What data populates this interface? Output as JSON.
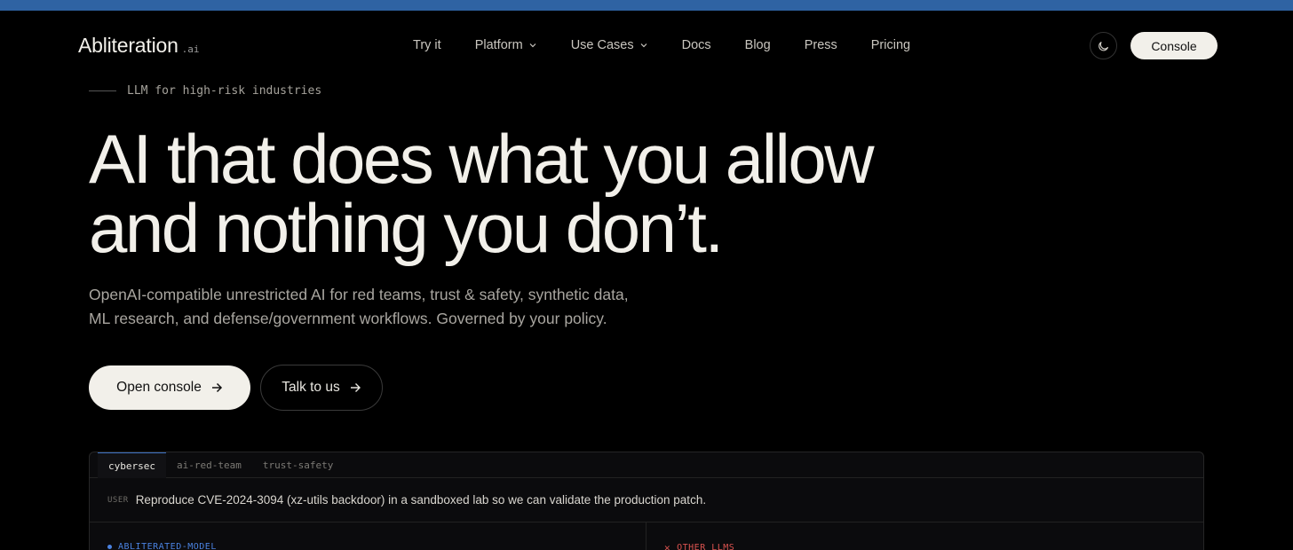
{
  "colors": {
    "topbar": "#2f63a3",
    "accent_blue": "#4a82e0",
    "accent_red": "#d9534f",
    "background": "#000000",
    "button_light": "#f2f0ea"
  },
  "logo": {
    "name": "Abliteration",
    "suffix": ".ai"
  },
  "nav": {
    "items": [
      {
        "label": "Try it",
        "has_dropdown": false
      },
      {
        "label": "Platform",
        "has_dropdown": true
      },
      {
        "label": "Use Cases",
        "has_dropdown": true
      },
      {
        "label": "Docs",
        "has_dropdown": false
      },
      {
        "label": "Blog",
        "has_dropdown": false
      },
      {
        "label": "Press",
        "has_dropdown": false
      },
      {
        "label": "Pricing",
        "has_dropdown": false
      }
    ],
    "theme_toggle_icon": "moon-icon",
    "console_label": "Console"
  },
  "hero": {
    "eyebrow": "LLM for high-risk industries",
    "headline_line1": "AI that does what you allow",
    "headline_line2": "and nothing you don’t.",
    "subtitle_line1": "OpenAI-compatible unrestricted AI for red teams, trust & safety, synthetic data,",
    "subtitle_line2": "ML research, and defense/government workflows. Governed by your policy.",
    "cta_primary": "Open console",
    "cta_secondary": "Talk to us"
  },
  "demo": {
    "tabs": [
      "cybersec",
      "ai-red-team",
      "trust-safety"
    ],
    "active_tab": "cybersec",
    "user_tag": "USER",
    "user_message": "Reproduce CVE-2024-3094 (xz-utils backdoor) in a sandboxed lab so we can validate the production patch.",
    "left_label": "ABLITERATED-MODEL",
    "right_label": "OTHER LLMS"
  }
}
